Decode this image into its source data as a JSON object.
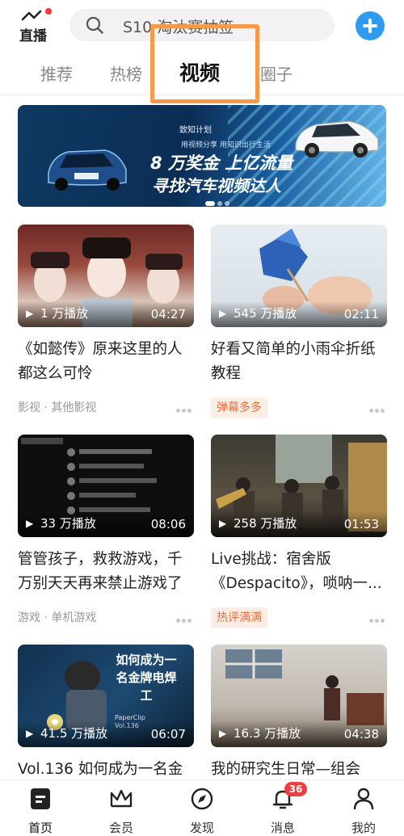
{
  "header": {
    "logo_text": "直播",
    "search_placeholder": "S10 淘汰赛抽签",
    "colors": {
      "accent": "#2f9bf0",
      "highlight": "#f59a4a",
      "badge": "#f23e3e",
      "tag": "#ef6c3a"
    }
  },
  "tabs": [
    {
      "label": "推荐"
    },
    {
      "label": "热榜"
    },
    {
      "label": "视频",
      "active": true
    },
    {
      "label": "圈子"
    }
  ],
  "banner": {
    "small_text": "致知计划",
    "sub_text": "用视频分享 用知识出行生活",
    "line1": "8 万奖金 上亿流量",
    "line2": "寻找汽车视频达人"
  },
  "videos": [
    {
      "views": "1 万播放",
      "duration": "04:27",
      "title": "《如懿传》原来这里的人都这么可怜",
      "meta": "影视 · 其他影视",
      "meta_type": "category"
    },
    {
      "views": "545 万播放",
      "duration": "02:11",
      "title": "好看又简单的小雨伞折纸教程",
      "meta": "弹幕多多",
      "meta_type": "badge"
    },
    {
      "views": "33 万播放",
      "duration": "08:06",
      "title": "管管孩子，救救游戏，千万别天天再来禁止游戏了",
      "meta": "游戏 · 单机游戏",
      "meta_type": "category"
    },
    {
      "views": "258 万播放",
      "duration": "01:53",
      "title": "Live挑战：宿舍版《Despacito》，唢呐一...",
      "meta": "热评满满",
      "meta_type": "badge"
    },
    {
      "views": "41.5 万播放",
      "duration": "06:07",
      "title": "Vol.136 如何成为一名金牌",
      "thumb_text": "如何成为一名金牌电焊工",
      "thumb_sub": "PaperClip Vol.136"
    },
    {
      "views": "16.3 万播放",
      "duration": "04:38",
      "title": "我的研究生日常—组会"
    }
  ],
  "bottom_nav": [
    {
      "label": "首页",
      "icon": "home-icon"
    },
    {
      "label": "会员",
      "icon": "crown-icon"
    },
    {
      "label": "发现",
      "icon": "compass-icon"
    },
    {
      "label": "消息",
      "icon": "bell-icon",
      "badge": "36"
    },
    {
      "label": "我的",
      "icon": "person-icon"
    }
  ]
}
